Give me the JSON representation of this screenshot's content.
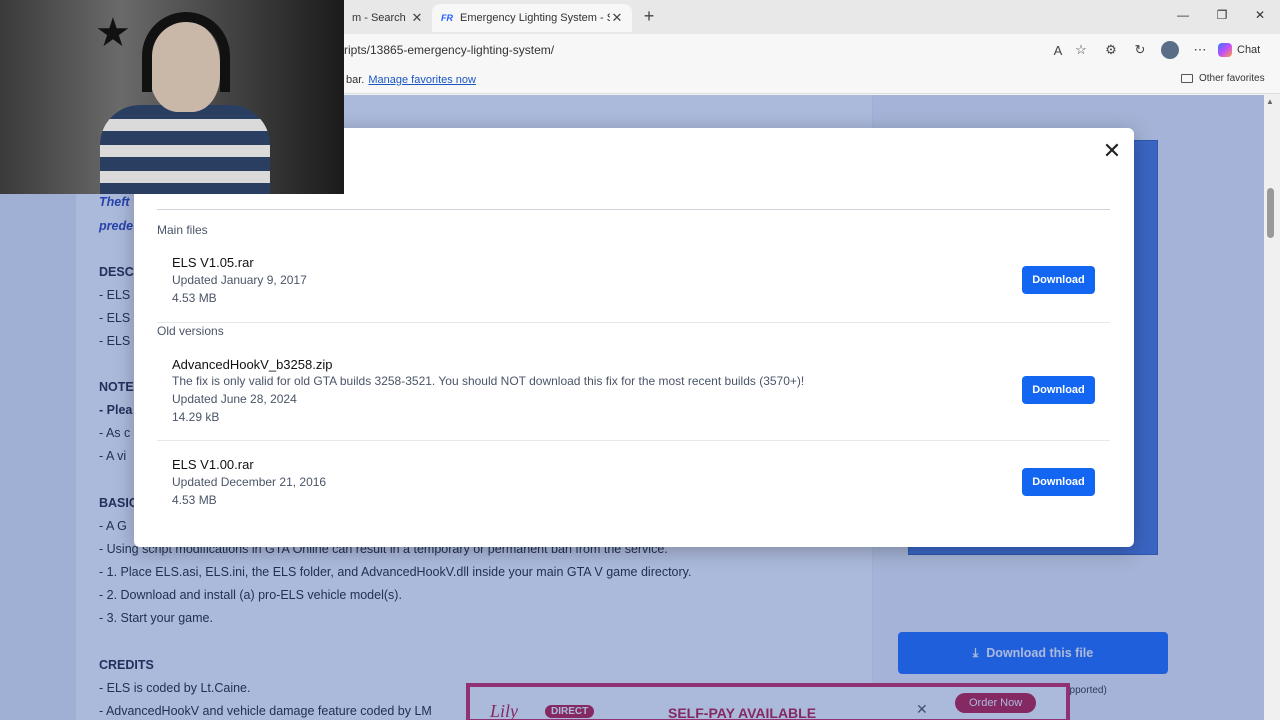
{
  "browser": {
    "tabs": [
      {
        "title": "m - Search",
        "active": false
      },
      {
        "title": "Emergency Lighting System - Scrip",
        "active": true,
        "favicon_text": "FR"
      }
    ],
    "url": "ripts/13865-emergency-lighting-system/",
    "favorites_bar": {
      "text": "bar.",
      "link": "Manage favorites now",
      "other": "Other favorites"
    },
    "chat_label": "Chat",
    "icons": [
      "read-aloud-icon",
      "favorite-star-icon",
      "extensions-icon",
      "history-icon",
      "more-icon"
    ]
  },
  "background_page": {
    "lines": [
      {
        "text": "Theft",
        "style": "i"
      },
      {
        "text": "prede",
        "style": "i"
      },
      {
        "text": "DESC",
        "style": "h"
      },
      {
        "text": "- ELS",
        "style": ""
      },
      {
        "text": "- ELS",
        "style": ""
      },
      {
        "text": "- ELS",
        "style": ""
      },
      {
        "text": "NOTE",
        "style": "h"
      },
      {
        "text": "- Plea",
        "style": "h"
      },
      {
        "text": "- As c",
        "style": ""
      },
      {
        "text": "- A vi",
        "style": ""
      },
      {
        "text": "BASIC",
        "style": "h"
      },
      {
        "text": "- A G",
        "style": ""
      },
      {
        "text": "- Using script modifications in GTA Online can result in a temporary or permanent ban from the service.",
        "style": ""
      },
      {
        "text": "- 1. Place ELS.asi, ELS.ini, the ELS folder, and  AdvancedHookV.dll inside your main GTA V game directory.",
        "style": ""
      },
      {
        "text": "- 2. Download and install (a) pro-ELS vehicle model(s).",
        "style": ""
      },
      {
        "text": "- 3. Start your game.",
        "style": ""
      },
      {
        "text": "CREDITS",
        "style": "h"
      },
      {
        "text": "- ELS is coded by Lt.Caine.",
        "style": ""
      },
      {
        "text": "- AdvancedHookV and vehicle damage feature coded by LM",
        "style": ""
      }
    ],
    "download_file_label": "Download this file",
    "supported_text": "upported)",
    "ad": {
      "brand": "Lily",
      "badge": "DIRECT",
      "headline": "SELF-PAY AVAILABLE",
      "cta": "Order Now"
    }
  },
  "modal": {
    "sections": [
      {
        "label": "Main files",
        "files": [
          {
            "name": "ELS V1.05.rar",
            "note": "",
            "updated": "Updated January 9, 2017",
            "size": "4.53 MB",
            "button": "Download"
          }
        ]
      },
      {
        "label": "Old versions",
        "files": [
          {
            "name": "AdvancedHookV_b3258.zip",
            "note": "The fix is only valid for old GTA builds 3258-3521. You should NOT download this fix for the most recent builds (3570+)!",
            "updated": "Updated June 28, 2024",
            "size": "14.29 kB",
            "button": "Download"
          },
          {
            "name": "ELS V1.00.rar",
            "note": "",
            "updated": "Updated December 21, 2016",
            "size": "4.53 MB",
            "button": "Download"
          }
        ]
      }
    ]
  }
}
